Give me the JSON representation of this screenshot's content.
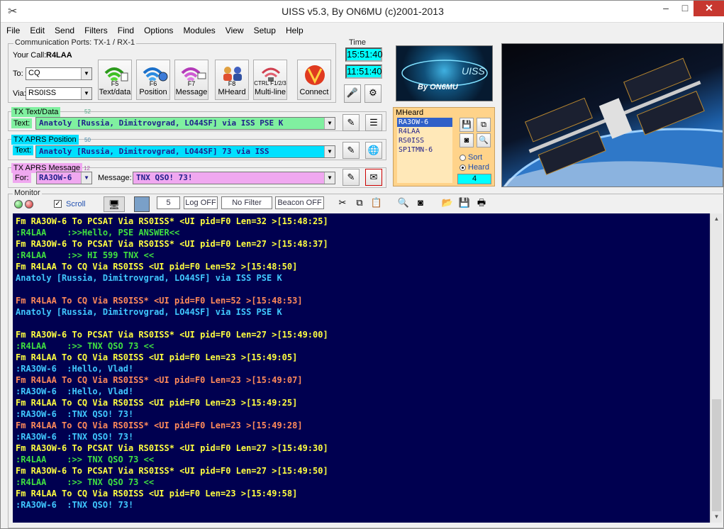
{
  "window": {
    "title": "UISS v5.3, By ON6MU (c)2001-2013",
    "minimize": "–",
    "maximize": "□",
    "close": "✕"
  },
  "menu": [
    "File",
    "Edit",
    "Send",
    "Filters",
    "Find",
    "Options",
    "Modules",
    "View",
    "Setup",
    "Help"
  ],
  "ports": {
    "label": "Communication Ports: TX-1 / RX-1",
    "your_call_label": "Your Call:",
    "your_call": "R4LAA"
  },
  "to": {
    "label": "To:",
    "value": "CQ"
  },
  "via": {
    "label": "Via:",
    "value": "RS0ISS"
  },
  "buttons": [
    {
      "label": "Text/data",
      "key": "F5"
    },
    {
      "label": "Position",
      "key": "F6"
    },
    {
      "label": "Message",
      "key": "F7"
    },
    {
      "label": "MHeard",
      "key": "F8"
    },
    {
      "label": "Multi-line",
      "key": "CTRL F1/2/3"
    },
    {
      "label": "Connect",
      "key": ""
    }
  ],
  "time": {
    "label": "Time",
    "t1": "15:51:40",
    "t2": "11:51:40"
  },
  "logo_text": "By ON6MU",
  "tx_text": {
    "tag": "TX Text/Data",
    "num": "52",
    "label": "Text:",
    "value": "Anatoly [Russia, Dimitrovgrad, LO44SF] via ISS PSE K"
  },
  "tx_aprs": {
    "tag": "TX APRS Position",
    "num": "50",
    "label": "Text:",
    "value": "Anatoly [Russia, Dimitrovgrad, LO44SF]  73 via ISS"
  },
  "tx_msg": {
    "tag": "TX APRS Message",
    "num": "12",
    "for_label": "For:",
    "for_value": "RA3OW-6",
    "msg_label": "Message:",
    "msg_value": "TNX QSO! 73!"
  },
  "mheard": {
    "tag": "MHeard",
    "items": [
      "RA3OW-6",
      "R4LAA",
      "RS0ISS",
      "SP1TMN-6"
    ],
    "sort_label": "Sort",
    "heard_label": "Heard",
    "count": "4"
  },
  "monitor": {
    "label": "Monitor",
    "scroll_label": "Scroll",
    "count": "5",
    "log_btn": "Log OFF",
    "filter_btn": "No Filter",
    "beacon_btn": "Beacon OFF"
  },
  "colors": {
    "yellow": "#ffff40",
    "green": "#40e040",
    "cyan": "#40c8ff",
    "orange": "#ff8a5a",
    "bg": "#000050"
  },
  "lines": [
    {
      "text": "Fm RA3OW-6 To PCSAT Via RS0ISS* <UI pid=F0 Len=32 >[15:48:25]",
      "color": "#ffff40"
    },
    {
      "text": ":R4LAA    :>>Hello, PSE ANSWER<<",
      "color": "#40e040"
    },
    {
      "text": "Fm RA3OW-6 To PCSAT Via RS0ISS* <UI pid=F0 Len=27 >[15:48:37]",
      "color": "#ffff40"
    },
    {
      "text": ":R4LAA    :>> HI 599 TNX <<",
      "color": "#40e040"
    },
    {
      "text": "Fm R4LAA To CQ Via RS0ISS <UI pid=F0 Len=52 >[15:48:50]",
      "color": "#ffff40"
    },
    {
      "text": "Anatoly [Russia, Dimitrovgrad, LO44SF] via ISS PSE K",
      "color": "#40c8ff"
    },
    {
      "text": "",
      "color": "#ffff40"
    },
    {
      "text": "Fm R4LAA To CQ Via RS0ISS* <UI pid=F0 Len=52 >[15:48:53]",
      "color": "#ff8a5a"
    },
    {
      "text": "Anatoly [Russia, Dimitrovgrad, LO44SF] via ISS PSE K",
      "color": "#40c8ff"
    },
    {
      "text": "",
      "color": "#ffff40"
    },
    {
      "text": "Fm RA3OW-6 To PCSAT Via RS0ISS* <UI pid=F0 Len=27 >[15:49:00]",
      "color": "#ffff40"
    },
    {
      "text": ":R4LAA    :>> TNX QSO 73 <<",
      "color": "#40e040"
    },
    {
      "text": "Fm R4LAA To CQ Via RS0ISS <UI pid=F0 Len=23 >[15:49:05]",
      "color": "#ffff40"
    },
    {
      "text": ":RA3OW-6  :Hello, Vlad!",
      "color": "#40c8ff"
    },
    {
      "text": "Fm R4LAA To CQ Via RS0ISS* <UI pid=F0 Len=23 >[15:49:07]",
      "color": "#ff8a5a"
    },
    {
      "text": ":RA3OW-6  :Hello, Vlad!",
      "color": "#40c8ff"
    },
    {
      "text": "Fm R4LAA To CQ Via RS0ISS <UI pid=F0 Len=23 >[15:49:25]",
      "color": "#ffff40"
    },
    {
      "text": ":RA3OW-6  :TNX QSO! 73!",
      "color": "#40c8ff"
    },
    {
      "text": "Fm R4LAA To CQ Via RS0ISS* <UI pid=F0 Len=23 >[15:49:28]",
      "color": "#ff8a5a"
    },
    {
      "text": ":RA3OW-6  :TNX QSO! 73!",
      "color": "#40c8ff"
    },
    {
      "text": "Fm RA3OW-6 To PCSAT Via RS0ISS* <UI pid=F0 Len=27 >[15:49:30]",
      "color": "#ffff40"
    },
    {
      "text": ":R4LAA    :>> TNX QSO 73 <<",
      "color": "#40e040"
    },
    {
      "text": "Fm RA3OW-6 To PCSAT Via RS0ISS* <UI pid=F0 Len=27 >[15:49:50]",
      "color": "#ffff40"
    },
    {
      "text": ":R4LAA    :>> TNX QSO 73 <<",
      "color": "#40e040"
    },
    {
      "text": "Fm R4LAA To CQ Via RS0ISS <UI pid=F0 Len=23 >[15:49:58]",
      "color": "#ffff40"
    },
    {
      "text": ":RA3OW-6  :TNX QSO! 73!",
      "color": "#40c8ff"
    }
  ]
}
